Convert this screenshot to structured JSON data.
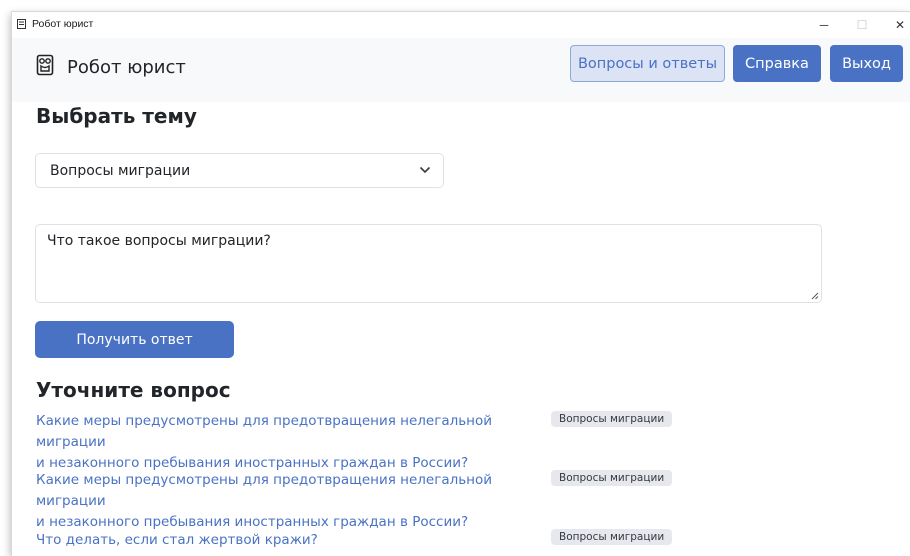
{
  "window": {
    "title": "Робот юрист",
    "controls": {
      "minimize": "─",
      "maximize": "☐",
      "close": "✕"
    }
  },
  "navbar": {
    "brand": "Робот юрист",
    "brand_icon": "owl-robot-icon",
    "buttons": {
      "faq": "Вопросы и ответы",
      "help": "Справка",
      "exit": "Выход"
    }
  },
  "topic": {
    "heading": "Выбрать тему",
    "selected": "Вопросы миграции"
  },
  "question": {
    "value": "Что такое вопросы миграции?"
  },
  "submit_label": "Получить ответ",
  "clarify": {
    "heading": "Уточните вопрос",
    "items": [
      {
        "line1": "Какие меры предусмотрены для предотвращения нелегальной миграции",
        "line2": "и незаконного пребывания иностранных граждан в России?",
        "tag": "Вопросы миграции"
      },
      {
        "line1": "Какие меры предусмотрены для предотвращения нелегальной миграции",
        "line2": "и незаконного пребывания иностранных граждан в России?",
        "tag": "Вопросы миграции"
      },
      {
        "line1": "Что делать, если стал жертвой кражи?",
        "line2": "",
        "tag": "Вопросы миграции"
      }
    ]
  },
  "colors": {
    "primary": "#4a72c4",
    "navbar_bg": "#f8f9fa",
    "badge_bg": "#e6e8ee"
  }
}
